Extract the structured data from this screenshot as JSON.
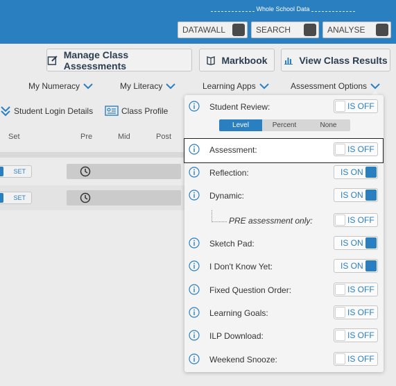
{
  "colors": {
    "brand_blue": "#2a7fc0",
    "panel_bg": "#f4f4f4",
    "toggle_on": "#2a7fc0"
  },
  "whole_school": {
    "label": "Whole School Data",
    "buttons": [
      "DATAWALL",
      "SEARCH",
      "ANALYSE"
    ]
  },
  "actions": {
    "manage": {
      "label": "Manage Class Assessments",
      "icon": "edit-icon"
    },
    "markbook": {
      "label": "Markbook",
      "icon": "book-icon"
    },
    "results": {
      "label": "View Class Results",
      "icon": "bar-chart-icon"
    }
  },
  "nav": {
    "numeracy": "My Numeracy",
    "literacy": "My Literacy",
    "apps": "Learning Apps",
    "assessment_options": "Assessment Options"
  },
  "links": {
    "student_login": "Student Login Details",
    "class_profile": "Class Profile"
  },
  "table": {
    "headers": [
      "Set",
      "Pre",
      "Mid",
      "Post"
    ],
    "rows": [
      {
        "set_label": "SET"
      },
      {
        "set_label": "SET"
      }
    ]
  },
  "options": {
    "student_review": {
      "label": "Student Review:",
      "state": "IS OFF"
    },
    "review_modes": [
      "Level",
      "Percent",
      "None"
    ],
    "review_mode_selected": "Level",
    "assessment": {
      "label": "Assessment:",
      "state": "IS OFF"
    },
    "reflection": {
      "label": "Reflection:",
      "state": "IS ON"
    },
    "dynamic": {
      "label": "Dynamic:",
      "state": "IS ON"
    },
    "pre_only": {
      "label": "PRE assessment only:",
      "state": "IS OFF"
    },
    "sketch_pad": {
      "label": "Sketch Pad:",
      "state": "IS ON"
    },
    "dont_know": {
      "label": "I Don't Know Yet:",
      "state": "IS ON"
    },
    "fixed_order": {
      "label": "Fixed Question Order:",
      "state": "IS OFF"
    },
    "learning_goals": {
      "label": "Learning Goals:",
      "state": "IS OFF"
    },
    "ilp_download": {
      "label": "ILP Download:",
      "state": "IS OFF"
    },
    "weekend_snooze": {
      "label": "Weekend Snooze:",
      "state": "IS OFF"
    }
  }
}
